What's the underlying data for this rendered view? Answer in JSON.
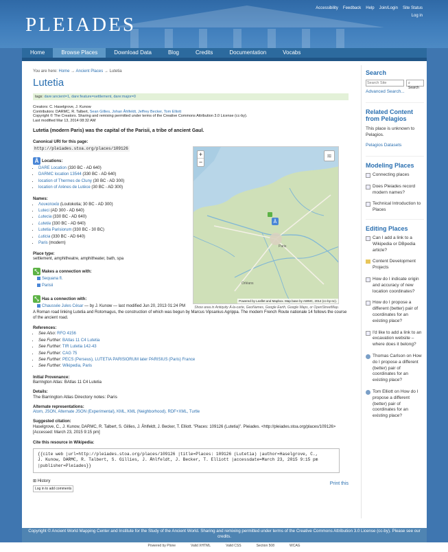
{
  "site": {
    "logo": "PLEIADES"
  },
  "util_links": [
    "Accessibility",
    "Feedback",
    "Help",
    "Join/Login",
    "Site Status"
  ],
  "login": "Log in",
  "nav": [
    {
      "label": "Home"
    },
    {
      "label": "Browse Places"
    },
    {
      "label": "Download Data"
    },
    {
      "label": "Blog"
    },
    {
      "label": "Credits"
    },
    {
      "label": "Documentation"
    },
    {
      "label": "Vocabs"
    }
  ],
  "breadcrumb": {
    "prefix": "You are here:",
    "items": [
      "Home",
      "Ancient Places",
      "Lutetia"
    ],
    "sep": "→"
  },
  "title": "Lutetia",
  "tags_label": "tags:",
  "tags": "dare:ancient=1, dare:feature=settlement, dare:major=0",
  "meta": {
    "creators": "Creators: C. Haselgrove, J. Kunow",
    "contributors_label": "Contributors: DARMC, R. Talbert,",
    "contributors_links": "Sean Gillies, Johan Åhlfeldt, Jeffrey Becker, Tom Elliott",
    "copyright": "Copyright © The Creators. Sharing and remixing permitted under terms of the Creative Commons Attribution 3.0 License (cc-by).",
    "modified": "Last modified Mar 13, 2014 08:32 AM"
  },
  "description": "Lutetia (modern Paris) was the capital of the Parisii, a tribe of ancient Gaul.",
  "canonical": {
    "label": "Canonical URI for this page:",
    "uri": "http://pleiades.stoa.org/places/109126"
  },
  "locations": {
    "label": "Locations:",
    "items": [
      {
        "link": "DARE Location",
        "rest": " (330 BC - AD 640)"
      },
      {
        "link": "DARMC location 13544",
        "rest": " (330 BC - AD 640)"
      },
      {
        "link": "location of Thermes de Cluny",
        "rest": " (30 BC - AD 300)"
      },
      {
        "link": "location of Arènes de Lutèce",
        "rest": " (30 BC - AD 300)"
      }
    ]
  },
  "names": {
    "label": "Names:",
    "items": [
      {
        "link": "Λουκοτοκία",
        "rest": " (Loutokotia; 30 BC - AD 300)"
      },
      {
        "link": "Luteci",
        "rest": " (AD 300 - AD 640)"
      },
      {
        "link": "Lutecia",
        "rest": " (330 BC - AD 640)"
      },
      {
        "link": "Lutetia",
        "rest": " (330 BC - AD 640)"
      },
      {
        "link": "Lutetia Parisiorum",
        "rest": " (330 BC - 30 BC)"
      },
      {
        "link": "Luticia",
        "rest": " (330 BC - AD 640)"
      },
      {
        "link": "Paris",
        "rest": " (modern)"
      }
    ]
  },
  "place_type": {
    "label": "Place type:",
    "value": "settlement, amphitheatre, amphitheater, bath, spa"
  },
  "makes_connection": {
    "label": "Makes a connection with:",
    "items": [
      "Sequana fl.",
      "Parisii"
    ]
  },
  "has_connection": {
    "label": "Has a connection with:",
    "link": "Chaussée Jules César",
    "rest": " — by J. Kunow — last modified Jun 20, 2013 01:24 PM",
    "text": "A Roman road linking Lutetia and Rotomagus, the construction of which was begun by Marcus Vipsanius Agrippa. The modern French Route nationale 14 follows the course of the ancient road."
  },
  "references": {
    "label": "References:",
    "items": [
      {
        "kind": "See Also:",
        "link": "RFO 4156"
      },
      {
        "kind": "See Further:",
        "link": "BAtlas 11 C4 Lutetia"
      },
      {
        "kind": "See Further:",
        "link": "TIR Lutetia 142-43"
      },
      {
        "kind": "See Further:",
        "link": "CAG 75"
      },
      {
        "kind": "See Further:",
        "link": "PECS (Perseus), LUTETIA PARISIORUM later PARISIUS (Paris) France"
      },
      {
        "kind": "See Further:",
        "link": "Wikipedia, Paris"
      }
    ]
  },
  "provenance": {
    "label": "Initial Provenance:",
    "value": "Barrington Atlas: BAtlas 11 C4 Lutetia"
  },
  "details": {
    "label": "Details:",
    "value": "The Barrington Atlas Directory notes: Paris"
  },
  "alternate": {
    "label": "Alternate representations:",
    "value": "Atom, JSON, Alternate JSON (Experimental), KML, KML (Neighborhood), RDF+XML, Turtle"
  },
  "citation": {
    "label": "Suggested citation:",
    "value": "Haselgrove, C., J. Kunow, DARMC, R. Talbert, S. Gillies, J. Åhlfeldt, J. Becker, T. Elliott. \"Places: 109126 (Lutetia)\". Pleiades. <http://pleiades.stoa.org/places/109126> [Accessed: March 23, 2015 9:15 pm]"
  },
  "wikipedia": {
    "label": "Cite this resource in Wikipedia:",
    "lines": [
      "{{cite web |url=http://pleiades.stoa.org/places/109126 |title=Places: 109126 (Lutetia) |author=Haselgrove, C.,",
      "J. Kunow, DARMC, R. Talbert, S. Gillies, J. Åhlfeldt, J. Becker, T. Elliott |accessdate=March 23, 2015 9:15 pm",
      "|publisher=Pleiades}}"
    ]
  },
  "history": "History",
  "login_comments": "Log in to add comments",
  "print": "Print this",
  "map": {
    "attribution": "Powered by Leaflet and Mapbox. Map base by AWMC, 2014 (cc-by-nc).",
    "caption": "Show area in Antiquity À-la-carte, GeoNames, Google Earth, Google Maps, or OpenStreetMap.",
    "zoom_in": "+",
    "zoom_out": "−",
    "labels": [
      {
        "id": "paris",
        "text": "Paris"
      },
      {
        "id": "orleans",
        "text": "Orléans"
      }
    ]
  },
  "sidebar": {
    "search": {
      "heading": "Search",
      "placeholder": "Search Site",
      "button": "Search",
      "advanced": "Advanced Search..."
    },
    "related": {
      "heading": "Related Content from Pelagios",
      "text": "This place is unknown to Pelagios.",
      "link": "Pelagios Datasets"
    },
    "modeling": {
      "heading": "Modeling Places",
      "items": [
        "Connecting places",
        "Does Pleiades record modern names?",
        "Technical Introduction to Places"
      ]
    },
    "editing": {
      "heading": "Editing Places",
      "items": [
        {
          "type": "page",
          "text": "Can I add a link to a Wikipedia or DBpedia article?"
        },
        {
          "type": "folder",
          "text": "Content Development Projects"
        },
        {
          "type": "page",
          "text": "How do I indicate origin and accuracy of new location coordinates?"
        },
        {
          "type": "page",
          "text": "How do I propose a different (better) pair of coordinates for an existing place?"
        },
        {
          "type": "page",
          "text": "I'd like to add a link to an excavation website – where does it belong?"
        },
        {
          "type": "user",
          "text": "Thomas Carlson on How do I propose a different (better) pair of coordinates for an existing place?"
        },
        {
          "type": "user",
          "text": "Tom Elliott on How do I propose a different (better) pair of coordinates for an existing place?"
        }
      ]
    }
  },
  "footer": "Copyright © Ancient World Mapping Center and Institute for the Study of the Ancient World. Sharing and remixing permitted under terms of the Creative Commons Attribution 3.0 License (cc-by). Please see our credits.",
  "bottom_links": [
    "Powered by Plone",
    "Valid XHTML",
    "Valid CSS",
    "Section 508",
    "WCAG"
  ]
}
